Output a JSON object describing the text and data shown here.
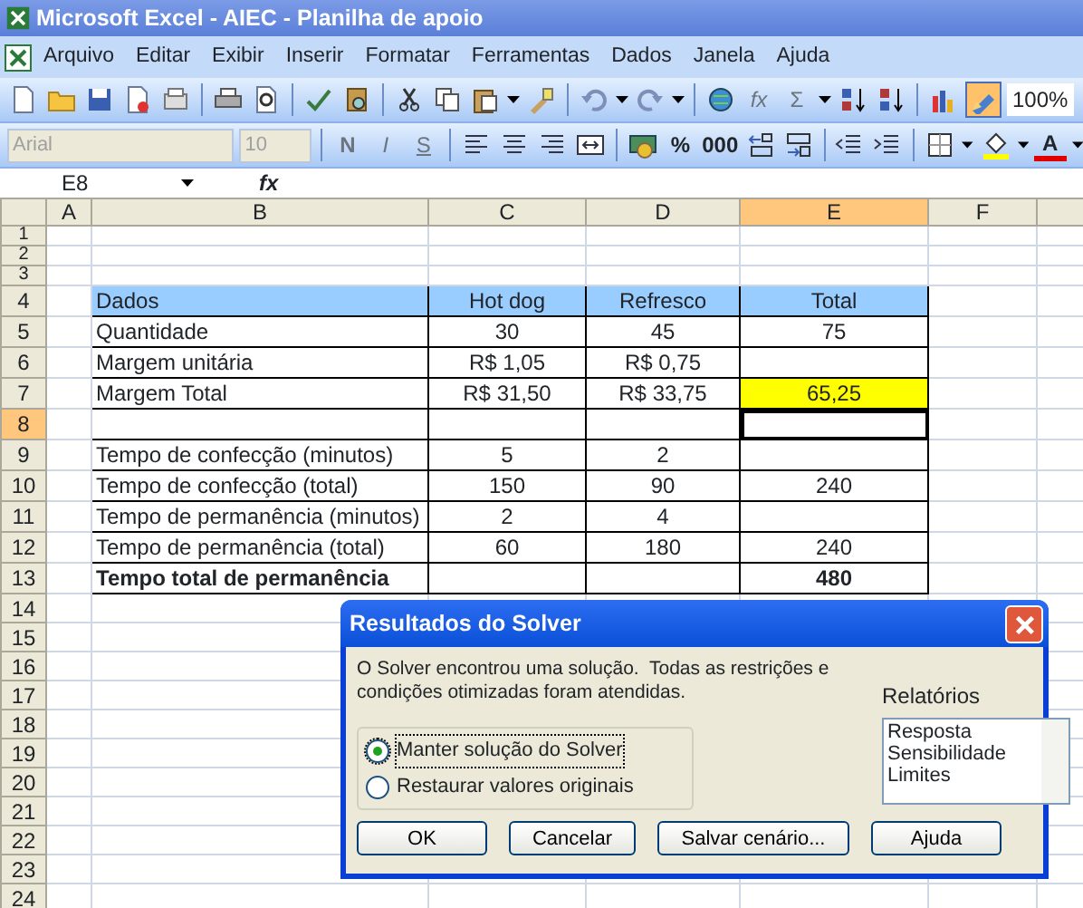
{
  "window": {
    "title": "Microsoft Excel - AIEC - Planilha de apoio"
  },
  "menu": [
    "Arquivo",
    "Editar",
    "Exibir",
    "Inserir",
    "Formatar",
    "Ferramentas",
    "Dados",
    "Janela",
    "Ajuda"
  ],
  "standard_toolbar": {
    "function_button": "fx",
    "autosum_button": "Σ",
    "zoom": "100%"
  },
  "formatting_toolbar": {
    "font": "Arial",
    "size": "10",
    "disabled": true,
    "bold": "N",
    "italic": "I",
    "underline": "S",
    "percent": "%",
    "thousands": "000",
    "font_color": "A"
  },
  "formula_bar": {
    "name_box": "E8",
    "function_label": "fx"
  },
  "sheet": {
    "columns": [
      {
        "label": "A",
        "selected": false
      },
      {
        "label": "B",
        "selected": false
      },
      {
        "label": "C",
        "selected": false
      },
      {
        "label": "D",
        "selected": false
      },
      {
        "label": "E",
        "selected": true
      },
      {
        "label": "F",
        "selected": false
      }
    ],
    "rows": [
      {
        "label": "1",
        "kind": "short",
        "selected": false
      },
      {
        "label": "2",
        "kind": "short",
        "selected": false
      },
      {
        "label": "3",
        "kind": "short",
        "selected": false
      },
      {
        "label": "4",
        "kind": "header",
        "selected": false,
        "cells": [
          "Dados",
          "Hot dog",
          "Refresco",
          "Total"
        ]
      },
      {
        "label": "5",
        "kind": "data",
        "selected": false,
        "cells": [
          "Quantidade",
          "30",
          "45",
          "75"
        ]
      },
      {
        "label": "6",
        "kind": "data",
        "selected": false,
        "cells": [
          "Margem unitária",
          "R$ 1,05",
          "R$ 0,75",
          null
        ]
      },
      {
        "label": "7",
        "kind": "data",
        "selected": false,
        "cells": [
          "Margem Total",
          "R$ 31,50",
          "R$ 33,75",
          {
            "text": "65,25",
            "color": "#ffff00"
          }
        ]
      },
      {
        "label": "8",
        "kind": "data",
        "selected": true,
        "cells": [
          null,
          null,
          null,
          null
        ]
      },
      {
        "label": "9",
        "kind": "data",
        "selected": false,
        "cells": [
          "Tempo de confecção (minutos)",
          "5",
          "2",
          null
        ]
      },
      {
        "label": "10",
        "kind": "data",
        "selected": false,
        "cells": [
          "Tempo de confecção (total)",
          "150",
          "90",
          "240"
        ]
      },
      {
        "label": "11",
        "kind": "data",
        "selected": false,
        "cells": [
          "Tempo de permanência (minutos)",
          "2",
          "4",
          null
        ]
      },
      {
        "label": "12",
        "kind": "data",
        "selected": false,
        "cells": [
          "Tempo de permanência (total)",
          "60",
          "180",
          "240"
        ]
      },
      {
        "label": "13",
        "kind": "total",
        "selected": false,
        "cells": [
          "Tempo total de permanência",
          null,
          null,
          "480"
        ]
      },
      {
        "label": "14",
        "kind": "plain",
        "selected": false
      },
      {
        "label": "15",
        "kind": "plain",
        "selected": false
      },
      {
        "label": "16",
        "kind": "plain",
        "selected": false
      },
      {
        "label": "17",
        "kind": "plain",
        "selected": false
      },
      {
        "label": "18",
        "kind": "plain",
        "selected": false
      },
      {
        "label": "19",
        "kind": "plain",
        "selected": false
      },
      {
        "label": "20",
        "kind": "plain",
        "selected": false
      },
      {
        "label": "21",
        "kind": "plain",
        "selected": false
      },
      {
        "label": "22",
        "kind": "plain",
        "selected": false
      },
      {
        "label": "23",
        "kind": "plain",
        "selected": false
      },
      {
        "label": "24",
        "kind": "plain",
        "selected": false
      }
    ]
  },
  "dialog": {
    "title": "Resultados do Solver",
    "message": "O Solver encontrou uma solução.  Todas as restrições e condições otimizadas foram atendidas.",
    "options": [
      {
        "label": "Manter solução do Solver",
        "selected": true
      },
      {
        "label": "Restaurar valores originais",
        "selected": false
      }
    ],
    "reports_label": "Relatórios",
    "reports": [
      "Resposta",
      "Sensibilidade",
      "Limites"
    ],
    "buttons": [
      "OK",
      "Cancelar",
      "Salvar cenário...",
      "Ajuda"
    ]
  }
}
